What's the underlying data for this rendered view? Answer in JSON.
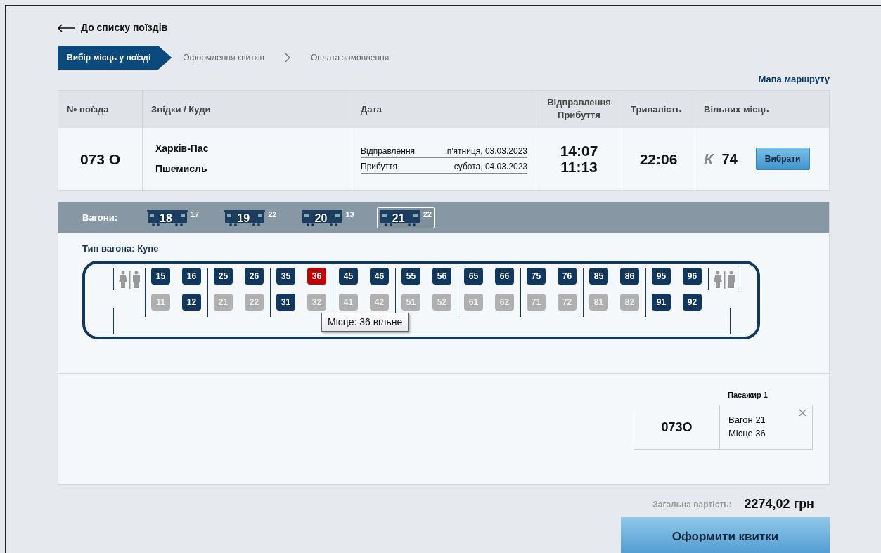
{
  "back_link": {
    "label": "До списку поїздів"
  },
  "steps": [
    {
      "label": "Вибір місць у поїзді",
      "selected": true
    },
    {
      "label": "Оформлення квитків",
      "selected": false
    },
    {
      "label": "Оплата замовлення",
      "selected": false
    }
  ],
  "route_map_link": "Мапа маршруту",
  "train_table": {
    "columns": [
      "№ поїзда",
      "Звідки / Куди",
      "Дата",
      "Відправлення Прибуття",
      "Тривалість",
      "Вільних місць"
    ],
    "row": {
      "train_number": "073 О",
      "from": "Харків-Пас",
      "to": "Пшемисль",
      "dates": [
        {
          "label": "Відправлення",
          "value": "п'ятниця, 03.03.2023"
        },
        {
          "label": "Прибуття",
          "value": "субота, 04.03.2023"
        }
      ],
      "departure": "14:07",
      "arrival": "11:13",
      "duration": "22:06",
      "class": "К",
      "free_seats": "74",
      "button": "Вибрати"
    }
  },
  "wagons": {
    "label": "Вагони:",
    "items": [
      {
        "number": "18",
        "free": "17",
        "selected": false
      },
      {
        "number": "19",
        "free": "22",
        "selected": false
      },
      {
        "number": "20",
        "free": "13",
        "selected": false
      },
      {
        "number": "21",
        "free": "22",
        "selected": true
      }
    ]
  },
  "wagon_type": "Тип вагона: Купе",
  "compartments": [
    {
      "top": [
        {
          "number": "15",
          "occupied": false,
          "selected": false
        },
        {
          "number": "16",
          "occupied": false,
          "selected": false
        }
      ],
      "bottom": [
        {
          "number": "11",
          "occupied": true,
          "selected": false
        },
        {
          "number": "12",
          "occupied": false,
          "selected": false
        }
      ]
    },
    {
      "top": [
        {
          "number": "25",
          "occupied": false,
          "selected": false
        },
        {
          "number": "26",
          "occupied": false,
          "selected": false
        }
      ],
      "bottom": [
        {
          "number": "21",
          "occupied": true,
          "selected": false
        },
        {
          "number": "22",
          "occupied": true,
          "selected": false
        }
      ]
    },
    {
      "top": [
        {
          "number": "35",
          "occupied": false,
          "selected": false
        },
        {
          "number": "36",
          "occupied": false,
          "selected": true
        }
      ],
      "bottom": [
        {
          "number": "31",
          "occupied": false,
          "selected": false
        },
        {
          "number": "32",
          "occupied": true,
          "selected": false
        }
      ]
    },
    {
      "top": [
        {
          "number": "45",
          "occupied": false,
          "selected": false
        },
        {
          "number": "46",
          "occupied": false,
          "selected": false
        }
      ],
      "bottom": [
        {
          "number": "41",
          "occupied": true,
          "selected": false
        },
        {
          "number": "42",
          "occupied": true,
          "selected": false
        }
      ]
    },
    {
      "top": [
        {
          "number": "55",
          "occupied": false,
          "selected": false
        },
        {
          "number": "56",
          "occupied": false,
          "selected": false
        }
      ],
      "bottom": [
        {
          "number": "51",
          "occupied": true,
          "selected": false
        },
        {
          "number": "52",
          "occupied": true,
          "selected": false
        }
      ]
    },
    {
      "top": [
        {
          "number": "65",
          "occupied": false,
          "selected": false
        },
        {
          "number": "66",
          "occupied": false,
          "selected": false
        }
      ],
      "bottom": [
        {
          "number": "61",
          "occupied": true,
          "selected": false
        },
        {
          "number": "62",
          "occupied": true,
          "selected": false
        }
      ]
    },
    {
      "top": [
        {
          "number": "75",
          "occupied": false,
          "selected": false
        },
        {
          "number": "76",
          "occupied": false,
          "selected": false
        }
      ],
      "bottom": [
        {
          "number": "71",
          "occupied": true,
          "selected": false
        },
        {
          "number": "72",
          "occupied": true,
          "selected": false
        }
      ]
    },
    {
      "top": [
        {
          "number": "85",
          "occupied": false,
          "selected": false
        },
        {
          "number": "86",
          "occupied": false,
          "selected": false
        }
      ],
      "bottom": [
        {
          "number": "81",
          "occupied": true,
          "selected": false
        },
        {
          "number": "82",
          "occupied": true,
          "selected": false
        }
      ]
    },
    {
      "top": [
        {
          "number": "95",
          "occupied": false,
          "selected": false
        },
        {
          "number": "96",
          "occupied": false,
          "selected": false
        }
      ],
      "bottom": [
        {
          "number": "91",
          "occupied": false,
          "selected": false
        },
        {
          "number": "92",
          "occupied": false,
          "selected": false
        }
      ]
    }
  ],
  "tooltip": "Місце: 36 вільне",
  "passenger": {
    "title": "Пасажир 1",
    "train": "073О",
    "wagon": "Вагон 21",
    "seat": "Місце 36"
  },
  "total": {
    "label": "Загальна вартість:",
    "value": "2274,02 грн"
  },
  "submit_button": "Оформити квитки"
}
